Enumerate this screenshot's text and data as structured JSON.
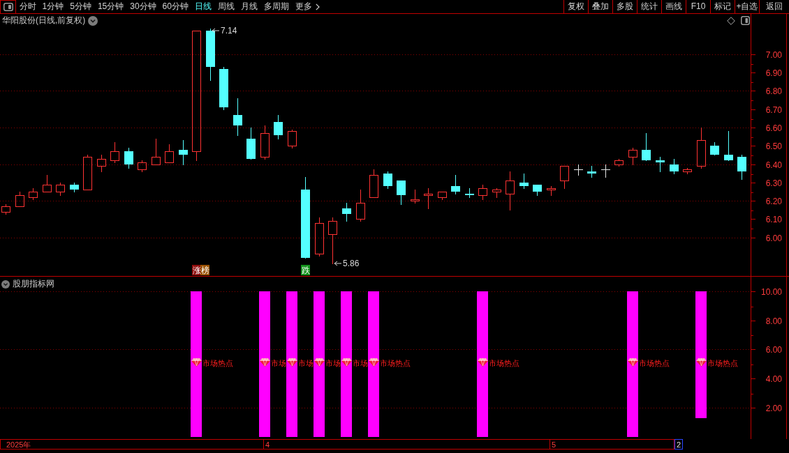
{
  "toolbar": {
    "period_tabs": [
      {
        "label": "分时",
        "selected": false
      },
      {
        "label": "1分钟",
        "selected": false
      },
      {
        "label": "5分钟",
        "selected": false
      },
      {
        "label": "15分钟",
        "selected": false
      },
      {
        "label": "30分钟",
        "selected": false
      },
      {
        "label": "60分钟",
        "selected": false
      },
      {
        "label": "日线",
        "selected": true
      },
      {
        "label": "周线",
        "selected": false
      },
      {
        "label": "月线",
        "selected": false
      },
      {
        "label": "多周期",
        "selected": false
      }
    ],
    "more_menu": {
      "label": "更多"
    },
    "buttons": [
      "复权",
      "叠加",
      "多股",
      "统计",
      "画线",
      "F10",
      "标记",
      "+自选",
      "返回"
    ]
  },
  "price_pane": {
    "title": "华阳股份(日线,前复权)",
    "chart_data": [
      {
        "type": "candlestick",
        "ohlc": [
          [
            6.14,
            6.18,
            6.13,
            6.17
          ],
          [
            6.17,
            6.25,
            6.17,
            6.23
          ],
          [
            6.22,
            6.27,
            6.21,
            6.25
          ],
          [
            6.25,
            6.34,
            6.25,
            6.29
          ],
          [
            6.25,
            6.3,
            6.23,
            6.29
          ],
          [
            6.29,
            6.3,
            6.25,
            6.26
          ],
          [
            6.26,
            6.45,
            6.26,
            6.44
          ],
          [
            6.39,
            6.45,
            6.36,
            6.43
          ],
          [
            6.42,
            6.52,
            6.41,
            6.47
          ],
          [
            6.47,
            6.49,
            6.38,
            6.4
          ],
          [
            6.37,
            6.42,
            6.36,
            6.41
          ],
          [
            6.4,
            6.54,
            6.4,
            6.44
          ],
          [
            6.41,
            6.51,
            6.41,
            6.47
          ],
          [
            6.48,
            6.53,
            6.4,
            6.45
          ],
          [
            6.47,
            7.13,
            6.42,
            7.13
          ],
          [
            7.13,
            7.14,
            6.86,
            6.93
          ],
          [
            6.92,
            6.93,
            6.7,
            6.71
          ],
          [
            6.67,
            6.76,
            6.56,
            6.61
          ],
          [
            6.54,
            6.6,
            6.43,
            6.43
          ],
          [
            6.44,
            6.61,
            6.43,
            6.57
          ],
          [
            6.63,
            6.67,
            6.54,
            6.56
          ],
          [
            6.5,
            6.59,
            6.49,
            6.58
          ],
          [
            6.26,
            6.33,
            5.89,
            5.89
          ],
          [
            5.91,
            6.11,
            5.9,
            6.08
          ],
          [
            6.02,
            6.11,
            5.86,
            6.09
          ],
          [
            6.16,
            6.19,
            6.09,
            6.13
          ],
          [
            6.1,
            6.26,
            6.09,
            6.19
          ],
          [
            6.22,
            6.37,
            6.22,
            6.34
          ],
          [
            6.35,
            6.36,
            6.27,
            6.28
          ],
          [
            6.31,
            6.31,
            6.18,
            6.23
          ],
          [
            6.2,
            6.26,
            6.19,
            6.21
          ],
          [
            6.23,
            6.27,
            6.16,
            6.24
          ],
          [
            6.22,
            6.25,
            6.21,
            6.25
          ],
          [
            6.28,
            6.34,
            6.24,
            6.25
          ],
          [
            6.24,
            6.27,
            6.22,
            6.23
          ],
          [
            6.23,
            6.29,
            6.21,
            6.27
          ],
          [
            6.25,
            6.27,
            6.22,
            6.26
          ],
          [
            6.24,
            6.36,
            6.15,
            6.31
          ],
          [
            6.3,
            6.35,
            6.27,
            6.28
          ],
          [
            6.29,
            6.29,
            6.23,
            6.25
          ],
          [
            6.26,
            6.28,
            6.23,
            6.27
          ],
          [
            6.31,
            6.39,
            6.27,
            6.39
          ],
          [
            6.37,
            6.4,
            6.34,
            6.37
          ],
          [
            6.36,
            6.39,
            6.33,
            6.35
          ],
          [
            6.37,
            6.4,
            6.33,
            6.37
          ],
          [
            6.4,
            6.43,
            6.39,
            6.42
          ],
          [
            6.44,
            6.49,
            6.4,
            6.48
          ],
          [
            6.48,
            6.57,
            6.42,
            6.42
          ],
          [
            6.42,
            6.44,
            6.36,
            6.41
          ],
          [
            6.4,
            6.43,
            6.35,
            6.36
          ],
          [
            6.36,
            6.38,
            6.35,
            6.37
          ],
          [
            6.39,
            6.6,
            6.38,
            6.53
          ],
          [
            6.5,
            6.52,
            6.45,
            6.45
          ],
          [
            6.45,
            6.58,
            6.42,
            6.42
          ],
          [
            6.44,
            6.45,
            6.32,
            6.36
          ]
        ],
        "ylim": [
          5.79,
          7.22
        ],
        "yticks": [
          {
            "value": 6.0,
            "label": "6.00"
          },
          {
            "value": 6.1,
            "label": "6.10"
          },
          {
            "value": 6.2,
            "label": "6.20"
          },
          {
            "value": 6.3,
            "label": "6.30"
          },
          {
            "value": 6.4,
            "label": "6.40"
          },
          {
            "value": 6.5,
            "label": "6.50"
          },
          {
            "value": 6.6,
            "label": "6.60"
          },
          {
            "value": 6.7,
            "label": "6.70"
          },
          {
            "value": 6.8,
            "label": "6.80"
          },
          {
            "value": 6.9,
            "label": "6.90"
          },
          {
            "value": 7.0,
            "label": "7.00"
          }
        ],
        "grid": true,
        "annotations": [
          "7.14",
          "5.86"
        ],
        "value_labels": [
          null,
          null,
          null,
          null,
          null,
          null,
          null,
          null,
          null,
          null,
          null,
          null,
          null,
          null,
          "涨榜",
          null,
          null,
          null,
          null,
          null,
          null,
          null,
          "跌",
          null,
          null,
          null,
          null,
          null,
          null,
          null,
          null,
          null,
          null,
          null,
          null,
          null,
          null,
          null,
          null,
          null,
          null,
          null,
          null,
          null,
          null,
          null,
          null,
          null,
          null,
          null,
          null,
          null,
          null,
          null,
          null
        ]
      }
    ]
  },
  "indicator_pane": {
    "title": "股朋指标网",
    "chart_data": [
      {
        "type": "bar",
        "categories": [
          "2025年",
          null,
          null,
          null,
          null,
          null,
          null,
          null,
          null,
          null,
          null,
          null,
          null,
          null,
          null,
          null,
          null,
          null,
          null,
          "4",
          null,
          null,
          null,
          null,
          null,
          null,
          null,
          null,
          null,
          null,
          null,
          null,
          null,
          null,
          null,
          null,
          null,
          null,
          null,
          null,
          "5",
          null,
          null,
          null,
          null,
          null,
          null,
          null,
          null,
          null,
          null,
          null,
          null,
          null,
          null
        ],
        "values": [
          null,
          null,
          null,
          null,
          null,
          null,
          null,
          null,
          null,
          null,
          null,
          null,
          null,
          null,
          10,
          null,
          null,
          null,
          null,
          10,
          null,
          10,
          null,
          10,
          null,
          10,
          null,
          10,
          null,
          null,
          null,
          null,
          null,
          null,
          null,
          10,
          null,
          null,
          null,
          null,
          null,
          null,
          null,
          null,
          null,
          null,
          10,
          null,
          null,
          null,
          null,
          8.7,
          null,
          null,
          null
        ],
        "base": [
          null,
          null,
          null,
          null,
          null,
          null,
          null,
          null,
          null,
          null,
          null,
          null,
          null,
          null,
          0,
          null,
          null,
          null,
          null,
          0,
          null,
          0,
          null,
          0,
          null,
          0,
          null,
          0,
          null,
          null,
          null,
          null,
          null,
          null,
          null,
          0,
          null,
          null,
          null,
          null,
          null,
          null,
          null,
          null,
          null,
          null,
          0,
          null,
          null,
          null,
          null,
          1.3,
          null,
          null,
          null
        ],
        "color": "#ff00ff",
        "ylim": [
          -0.15,
          11
        ],
        "yticks": [
          {
            "value": 2,
            "label": "2.00"
          },
          {
            "value": 4,
            "label": "4.00"
          },
          {
            "value": 6,
            "label": "6.00"
          },
          {
            "value": 8,
            "label": "8.00"
          },
          {
            "value": 10,
            "label": "10.00"
          }
        ],
        "grid": true,
        "value_labels": [
          null,
          null,
          null,
          null,
          null,
          null,
          null,
          null,
          null,
          null,
          null,
          null,
          null,
          null,
          "市场热点",
          null,
          null,
          null,
          null,
          "市场",
          null,
          "市场",
          null,
          "市场",
          null,
          "市场",
          null,
          "市场热点",
          null,
          null,
          null,
          null,
          null,
          null,
          null,
          "市场热点",
          null,
          null,
          null,
          null,
          null,
          null,
          null,
          null,
          null,
          null,
          "市场热点",
          null,
          null,
          null,
          null,
          "市场热点",
          null,
          null,
          null
        ]
      }
    ]
  },
  "date_cursor": "2"
}
